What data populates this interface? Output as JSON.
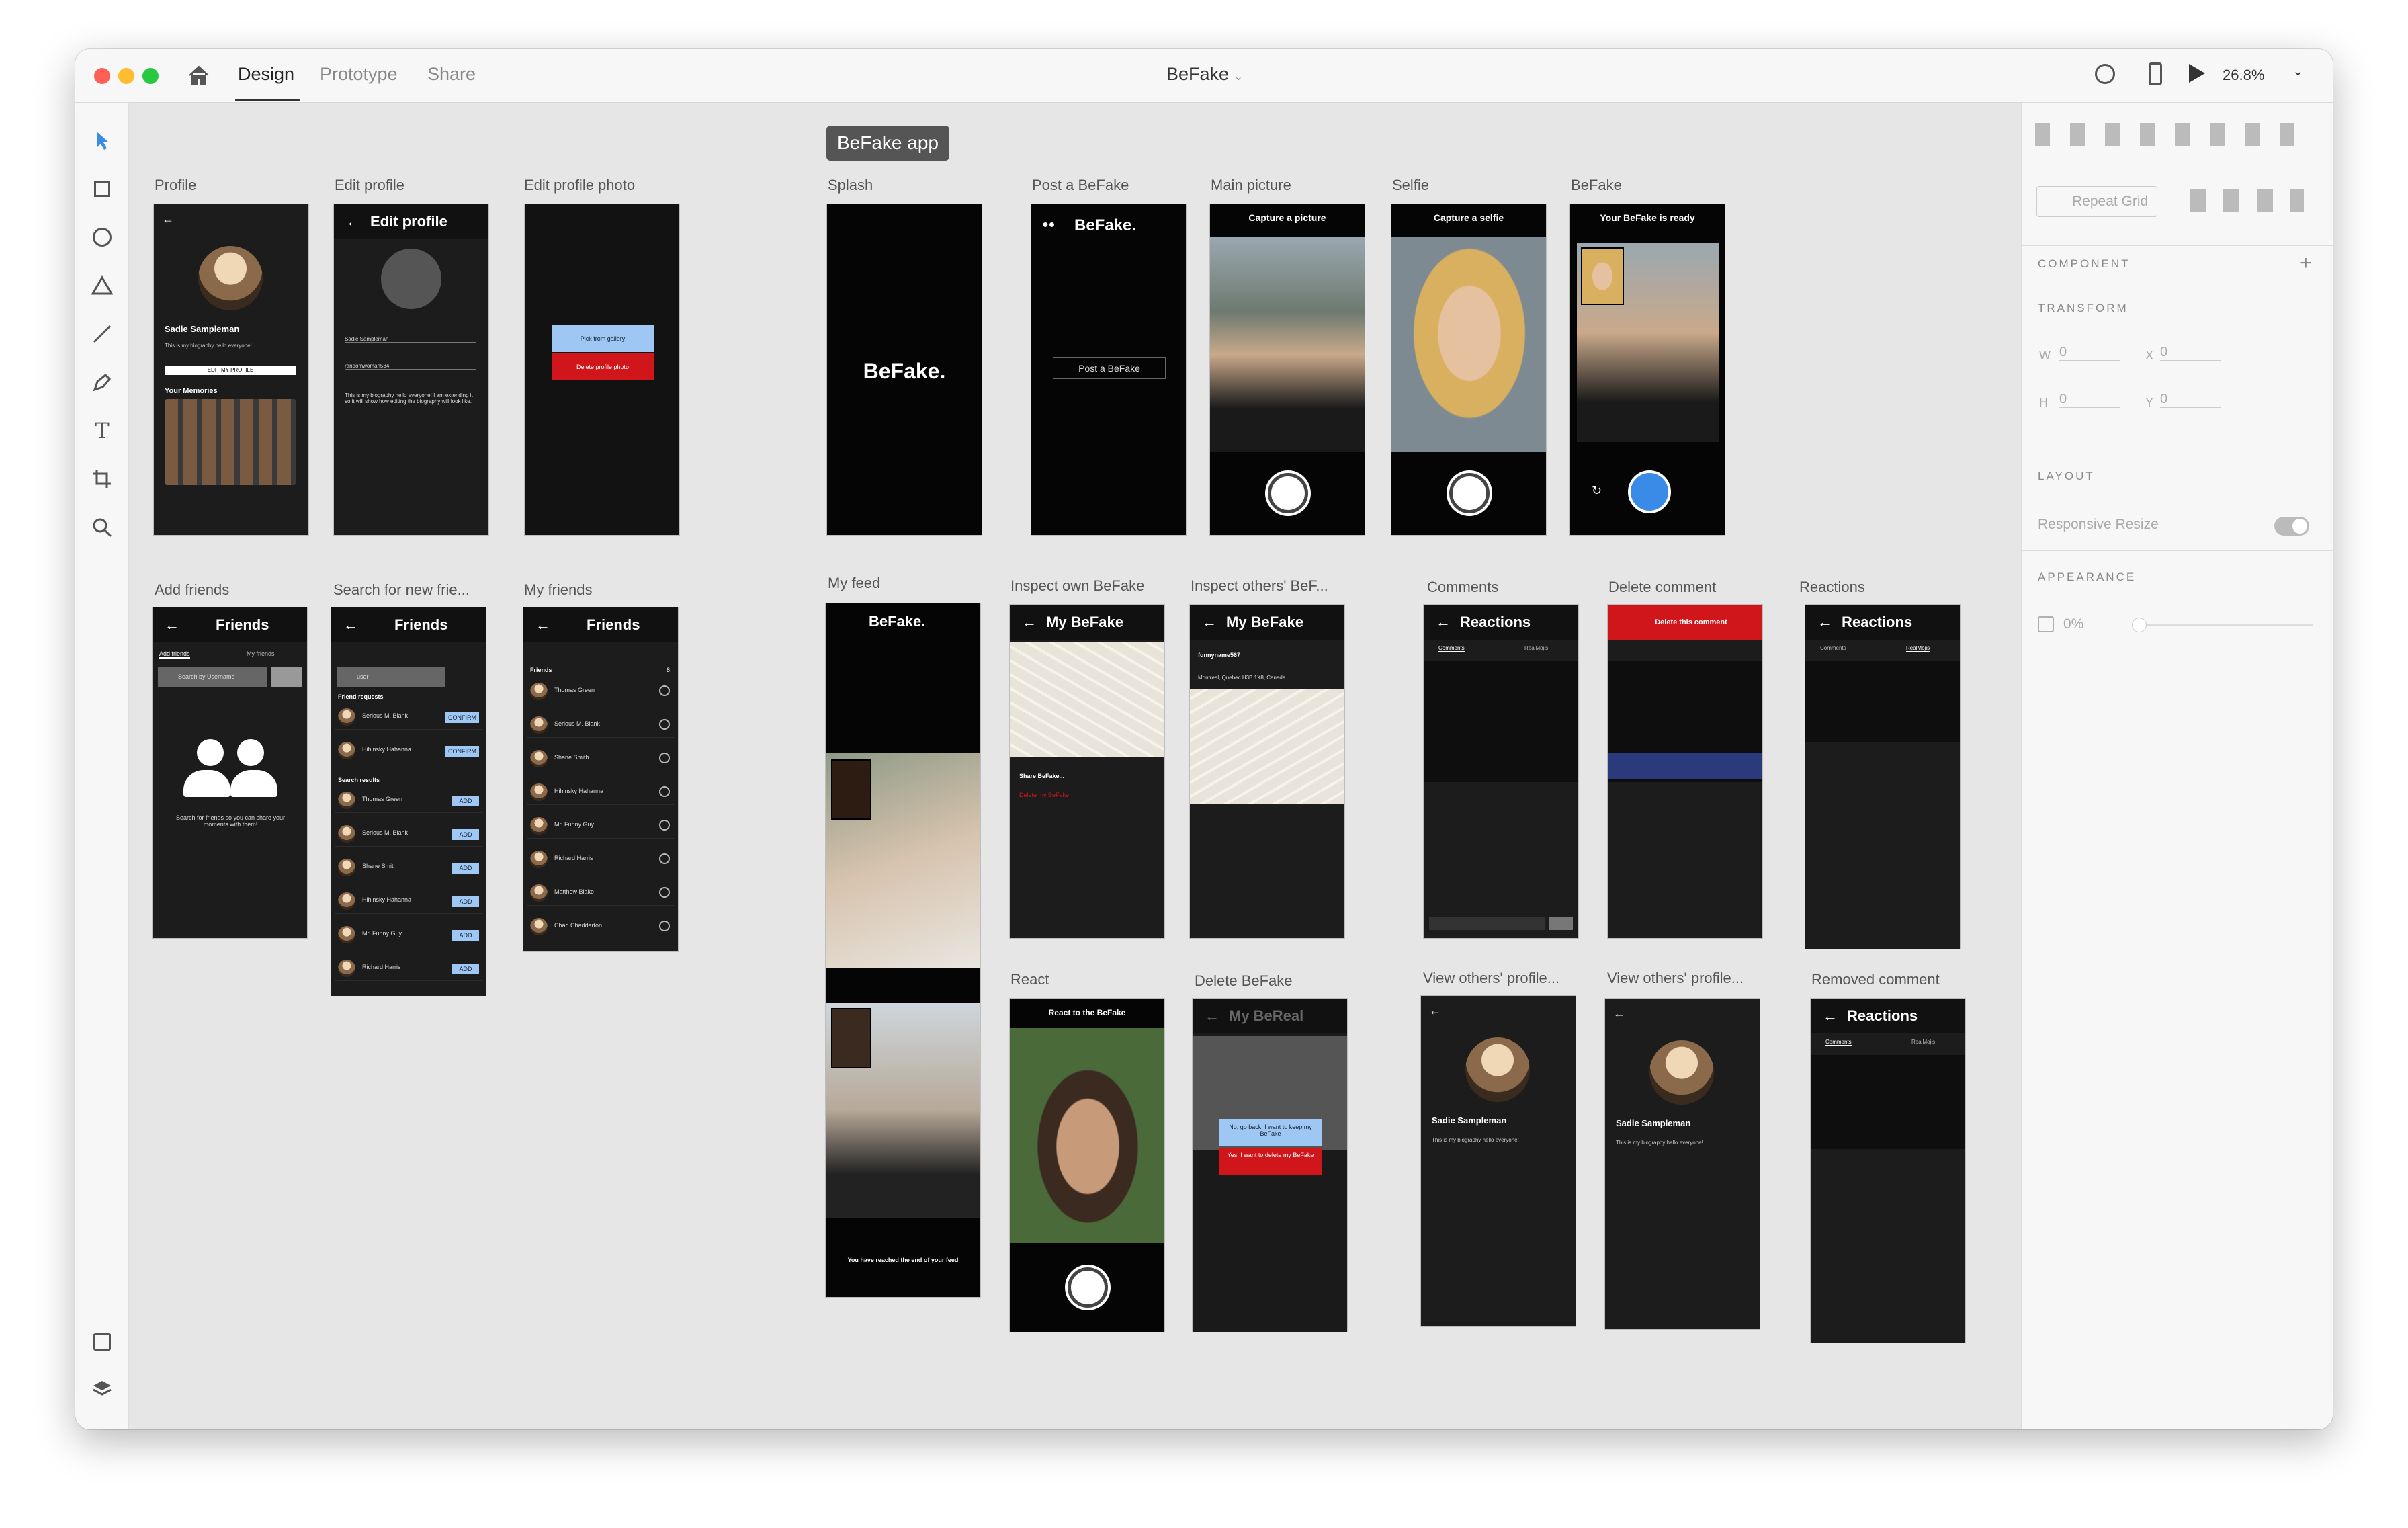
{
  "titlebar": {
    "tabs": [
      "Design",
      "Prototype",
      "Share"
    ],
    "doc_title": "BeFake",
    "zoom": "26.8%"
  },
  "canvas": {
    "group_label": "BeFake app",
    "artboards": {
      "profile": "Profile",
      "edit_profile": "Edit profile",
      "edit_profile_photo": "Edit profile photo",
      "splash": "Splash",
      "post": "Post a BeFake",
      "main_picture": "Main picture",
      "selfie": "Selfie",
      "befake": "BeFake",
      "add_friends": "Add friends",
      "search_friends": "Search for new frie...",
      "my_friends": "My friends",
      "my_feed": "My feed",
      "inspect_own": "Inspect own BeFake",
      "inspect_others": "Inspect others' BeF...",
      "comments": "Comments",
      "delete_comment": "Delete comment",
      "reactions": "Reactions",
      "react": "React",
      "delete_befake": "Delete BeFake",
      "view_others_1": "View others' profile...",
      "view_others_2": "View others' profile...",
      "removed_comment": "Removed comment"
    },
    "screens": {
      "profile_name": "Sadie Sampleman",
      "profile_bio": "This is my biography hello everyone!",
      "edit_my_profile": "EDIT MY PROFILE",
      "your_memories": "Your Memories",
      "edit_profile_header": "Edit profile",
      "full_name": "Sadie Sampleman",
      "username": "randomwoman534",
      "bio_text": "This is my biography hello everyone! I am extending it so it will show how editing the biography will look like.",
      "pick_gallery": "Pick from gallery",
      "delete_photo": "Delete profile photo",
      "splash_logo": "BeFake.",
      "post_logo": "BeFake.",
      "post_button": "Post a BeFake",
      "capture_picture": "Capture a picture",
      "capture_selfie": "Capture a selfie",
      "ready": "Your BeFake is ready",
      "friends_title": "Friends",
      "tab_add": "Add friends",
      "tab_my": "My friends",
      "search_placeholder": "Search by Username",
      "search_value": "user",
      "empty_friends": "Search for friends so you can share your moments with them!",
      "friend_requests": "Friend requests",
      "search_results": "Search results",
      "confirm": "CONFIRM",
      "add": "ADD",
      "friends_section": "Friends",
      "friend_count": "8",
      "request_people": [
        "Serious M. Blank",
        "Hihinsky Hahanna"
      ],
      "result_people": [
        "Thomas Green",
        "Serious M. Blank",
        "Shane Smith",
        "Hihinsky Hahanna",
        "Mr. Funny Guy",
        "Richard Harris"
      ],
      "my_friend_people": [
        "Thomas Green",
        "Serious M. Blank",
        "Shane Smith",
        "Hihinsky Hahanna",
        "Mr. Funny Guy",
        "Richard Harris",
        "Matthew Blake",
        "Chad Chadderton"
      ],
      "feed_logo": "BeFake.",
      "feed_end": "You have reached the end of your feed",
      "my_befake": "My BeFake",
      "share_befake": "Share BeFake...",
      "delete_my_befake": "Delete my BeFake",
      "others_user": "funnyname567",
      "others_location": "Montreal, Quebec H3B 1X8, Canada",
      "reactions_title": "Reactions",
      "tab_comments": "Comments",
      "tab_realmojis": "RealMojis",
      "delete_this_comment": "Delete this comment",
      "react_title": "React to the BeFake",
      "my_bereal": "My BeReal",
      "keep_befake": "No, go back, I want to keep my BeFake",
      "delete_befake_confirm": "Yes, I want to delete my BeFake",
      "view_name": "Sadie Sampleman",
      "view_bio": "This is my biography hello everyone!"
    }
  },
  "panel": {
    "repeat_grid": "Repeat Grid",
    "component": "COMPONENT",
    "transform": "TRANSFORM",
    "w_label": "W",
    "w_value": "0",
    "x_label": "X",
    "x_value": "0",
    "h_label": "H",
    "h_value": "0",
    "y_label": "Y",
    "y_value": "0",
    "layout": "LAYOUT",
    "responsive_resize": "Responsive Resize",
    "appearance": "APPEARANCE",
    "opacity": "0%"
  }
}
